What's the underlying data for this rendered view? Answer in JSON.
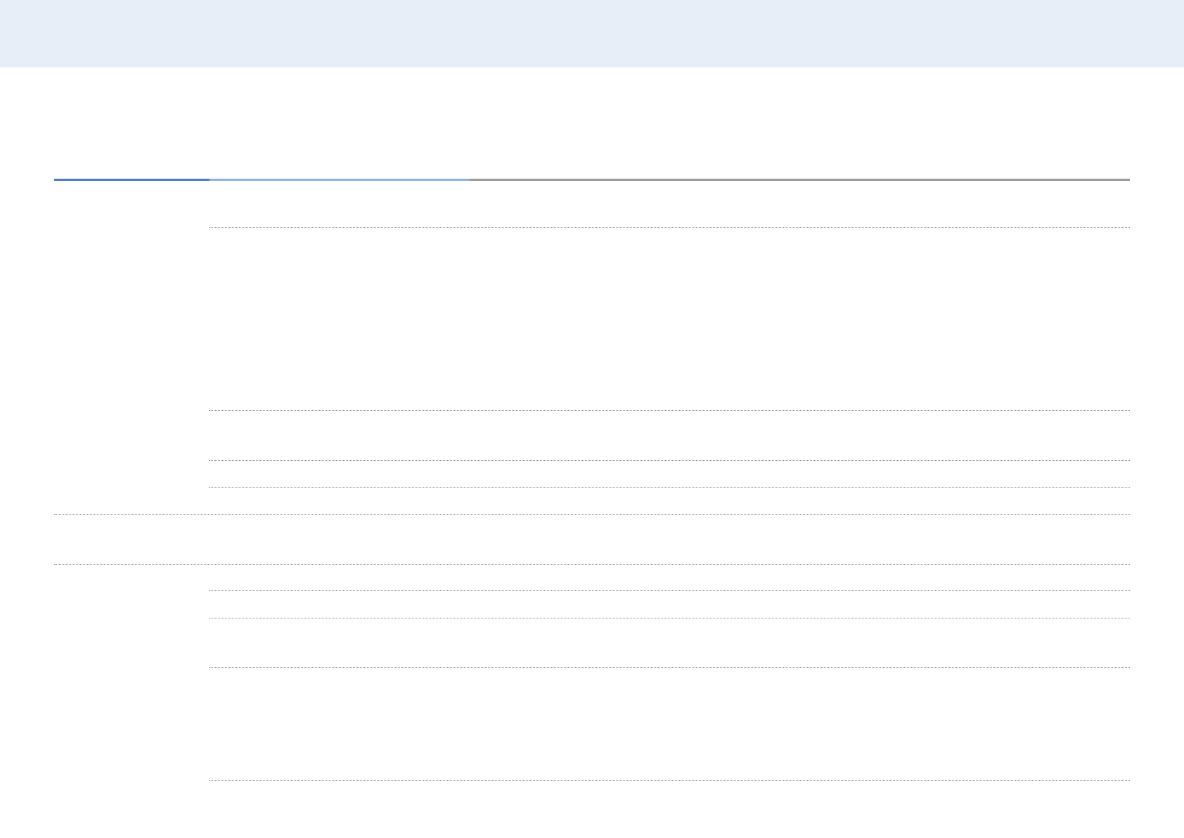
{
  "header": {
    "band_color": "#e8eef8"
  },
  "title_rule": {
    "segment_colors": [
      "#4a7cc2",
      "#8fb0e0",
      "#9a9a9a"
    ]
  },
  "rules": {
    "style": "dotted",
    "color": "#8a8a8a"
  }
}
